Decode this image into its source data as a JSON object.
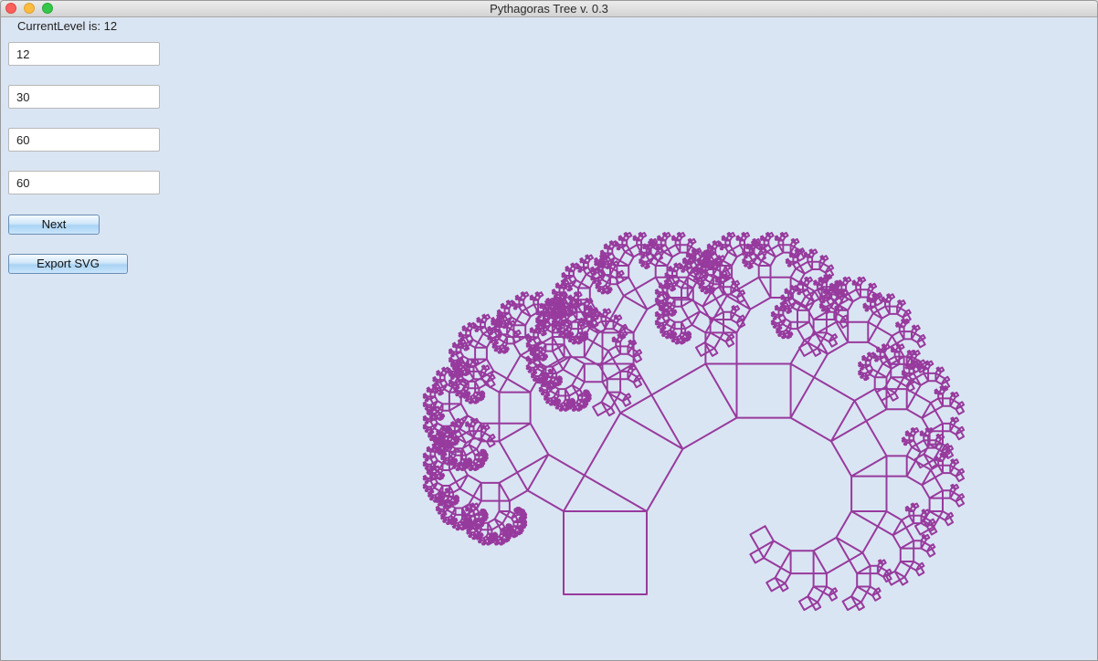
{
  "window": {
    "title": "Pythagoras Tree v. 0.3"
  },
  "status": {
    "level_text": "CurrentLevel is: 12"
  },
  "inputs": [
    {
      "value": "12"
    },
    {
      "value": "30"
    },
    {
      "value": "60"
    },
    {
      "value": "60"
    }
  ],
  "buttons": {
    "next_label": "Next",
    "export_label": "Export SVG"
  },
  "tree": {
    "levels": 12,
    "stroke_color": "#800080",
    "background": "#dae5f3"
  }
}
